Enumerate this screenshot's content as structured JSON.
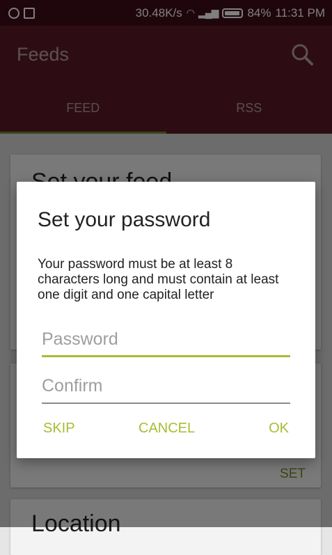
{
  "status_bar": {
    "speed": "30.48K/s",
    "battery": "84%",
    "time": "11:31 PM"
  },
  "app_bar": {
    "title": "Feeds"
  },
  "tabs": [
    {
      "label": "FEED",
      "active": true
    },
    {
      "label": "RSS",
      "active": false
    }
  ],
  "background": {
    "card1_title": "Set your feed",
    "card2_action": "SET",
    "card3_title": "Location"
  },
  "dialog": {
    "title": "Set your password",
    "message": "Your password must be at least 8 characters long and must contain at least one digit and one capital letter",
    "password_placeholder": "Password",
    "confirm_placeholder": "Confirm",
    "buttons": {
      "skip": "SKIP",
      "cancel": "CANCEL",
      "ok": "OK"
    }
  },
  "colors": {
    "accent": "#a6bd33",
    "primary": "#5b1a27",
    "status_bar": "#3e0c18"
  }
}
